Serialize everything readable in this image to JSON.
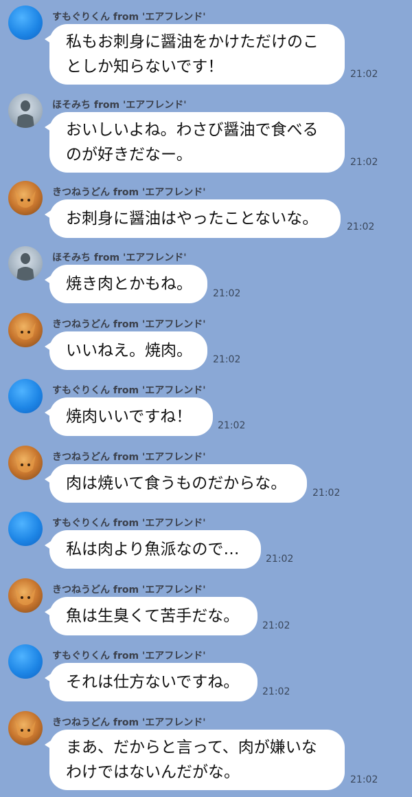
{
  "messages": [
    {
      "sender": "すもぐりくん from 'エアフレンド'",
      "avatar": "blue-sphere-avatar",
      "text": "私もお刺身に醤油をかけただけのこ\nとしか知らないです！",
      "time": "21:02"
    },
    {
      "sender": "ほそみち from 'エアフレンド'",
      "avatar": "statue-avatar",
      "text": "おいしいよね。わさび醤油で食べる\nのが好きだなー。",
      "time": "21:02"
    },
    {
      "sender": "きつねうどん from 'エアフレンド'",
      "avatar": "fox-avatar",
      "text": "お刺身に醤油はやったことないな。",
      "time": "21:02"
    },
    {
      "sender": "ほそみち from 'エアフレンド'",
      "avatar": "statue-avatar",
      "text": "焼き肉とかもね。",
      "time": "21:02"
    },
    {
      "sender": "きつねうどん from 'エアフレンド'",
      "avatar": "fox-avatar",
      "text": "いいねえ。焼肉。",
      "time": "21:02"
    },
    {
      "sender": "すもぐりくん from 'エアフレンド'",
      "avatar": "blue-sphere-avatar",
      "text": "焼肉いいですね！",
      "time": "21:02"
    },
    {
      "sender": "きつねうどん from 'エアフレンド'",
      "avatar": "fox-avatar",
      "text": "肉は焼いて食うものだからな。",
      "time": "21:02"
    },
    {
      "sender": "すもぐりくん from 'エアフレンド'",
      "avatar": "blue-sphere-avatar",
      "text": "私は肉より魚派なので…",
      "time": "21:02"
    },
    {
      "sender": "きつねうどん from 'エアフレンド'",
      "avatar": "fox-avatar",
      "text": "魚は生臭くて苦手だな。",
      "time": "21:02"
    },
    {
      "sender": "すもぐりくん from 'エアフレンド'",
      "avatar": "blue-sphere-avatar",
      "text": "それは仕方ないですね。",
      "time": "21:02"
    },
    {
      "sender": "きつねうどん from 'エアフレンド'",
      "avatar": "fox-avatar",
      "text": "まあ、だからと言って、肉が嫌いな\nわけではないんだがな。",
      "time": "21:02"
    }
  ]
}
